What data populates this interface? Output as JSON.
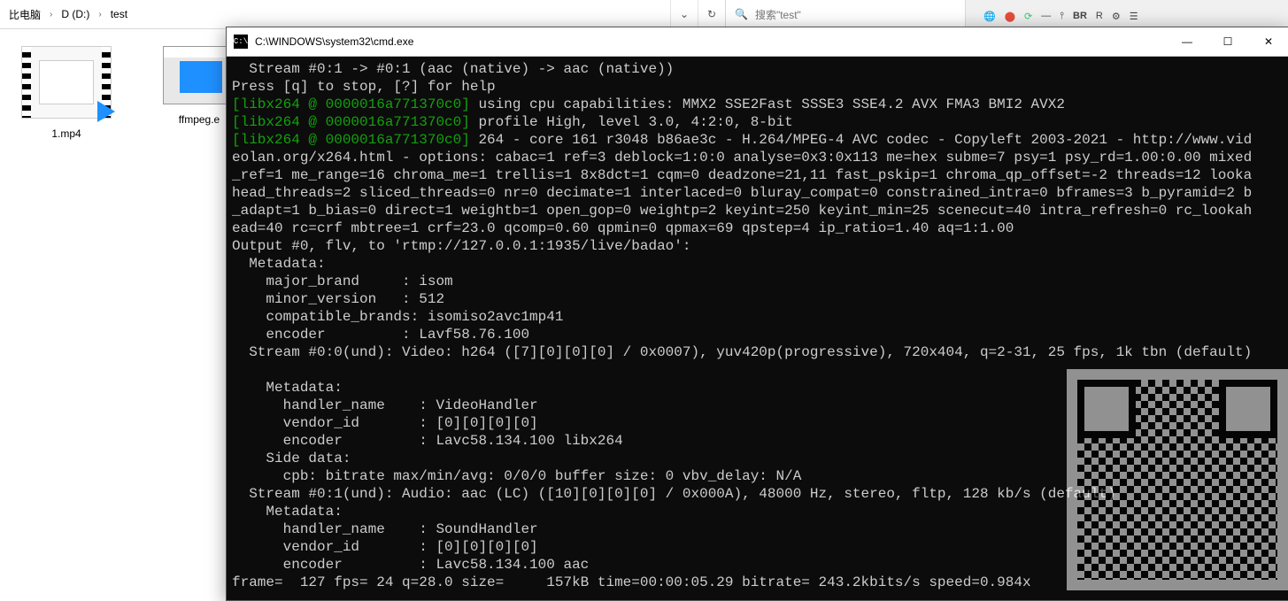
{
  "explorer": {
    "crumb1": "比电脑",
    "crumb2": "D (D:)",
    "crumb3": "test",
    "search_placeholder": "搜索\"test\""
  },
  "files": {
    "item1_label": "1.mp4",
    "item2_label": "ffmpeg.e"
  },
  "toolbar_icons": {
    "globe": "🌐",
    "star": "⬤",
    "refresh": "⟳",
    "dash": "—",
    "eq": "⫯",
    "br": "BR",
    "r": "R",
    "cog": "⚙",
    "dots": "☰"
  },
  "cmd": {
    "title": "C:\\WINDOWS\\system32\\cmd.exe",
    "min": "—",
    "max": "☐",
    "close": "✕"
  },
  "term": {
    "l01a": "  Stream #0:1 -> #0:1 (aac (native) -> aac (native))",
    "l02a": "Press [q] to stop, [?] for help",
    "l03a": "[libx264 @ 0000016a771370c0]",
    "l03b": " using cpu capabilities: MMX2 SSE2Fast SSSE3 SSE4.2 AVX FMA3 BMI2 AVX2",
    "l04a": "[libx264 @ 0000016a771370c0]",
    "l04b": " profile High, level 3.0, 4:2:0, 8-bit",
    "l05a": "[libx264 @ 0000016a771370c0]",
    "l05b": " 264 - core 161 r3048 b86ae3c - H.264/MPEG-4 AVC codec - Copyleft 2003-2021 - http://www.vid",
    "l06": "eolan.org/x264.html - options: cabac=1 ref=3 deblock=1:0:0 analyse=0x3:0x113 me=hex subme=7 psy=1 psy_rd=1.00:0.00 mixed",
    "l07": "_ref=1 me_range=16 chroma_me=1 trellis=1 8x8dct=1 cqm=0 deadzone=21,11 fast_pskip=1 chroma_qp_offset=-2 threads=12 looka",
    "l08": "head_threads=2 sliced_threads=0 nr=0 decimate=1 interlaced=0 bluray_compat=0 constrained_intra=0 bframes=3 b_pyramid=2 b",
    "l09": "_adapt=1 b_bias=0 direct=1 weightb=1 open_gop=0 weightp=2 keyint=250 keyint_min=25 scenecut=40 intra_refresh=0 rc_lookah",
    "l10": "ead=40 rc=crf mbtree=1 crf=23.0 qcomp=0.60 qpmin=0 qpmax=69 qpstep=4 ip_ratio=1.40 aq=1:1.00",
    "l11": "Output #0, flv, to 'rtmp://127.0.0.1:1935/live/badao':",
    "l12": "  Metadata:",
    "l13": "    major_brand     : isom",
    "l14": "    minor_version   : 512",
    "l15": "    compatible_brands: isomiso2avc1mp41",
    "l16": "    encoder         : Lavf58.76.100",
    "l17": "  Stream #0:0(und): Video: h264 ([7][0][0][0] / 0x0007), yuv420p(progressive), 720x404, q=2-31, 25 fps, 1k tbn (default)",
    "l18": "",
    "l19": "    Metadata:",
    "l20": "      handler_name    : VideoHandler",
    "l21": "      vendor_id       : [0][0][0][0]",
    "l22": "      encoder         : Lavc58.134.100 libx264",
    "l23": "    Side data:",
    "l24": "      cpb: bitrate max/min/avg: 0/0/0 buffer size: 0 vbv_delay: N/A",
    "l25": "  Stream #0:1(und): Audio: aac (LC) ([10][0][0][0] / 0x000A), 48000 Hz, stereo, fltp, 128 kb/s (default)",
    "l26": "    Metadata:",
    "l27": "      handler_name    : SoundHandler",
    "l28": "      vendor_id       : [0][0][0][0]",
    "l29": "      encoder         : Lavc58.134.100 aac",
    "l30": "frame=  127 fps= 24 q=28.0 size=     157kB time=00:00:05.29 bitrate= 243.2kbits/s speed=0.984x"
  }
}
